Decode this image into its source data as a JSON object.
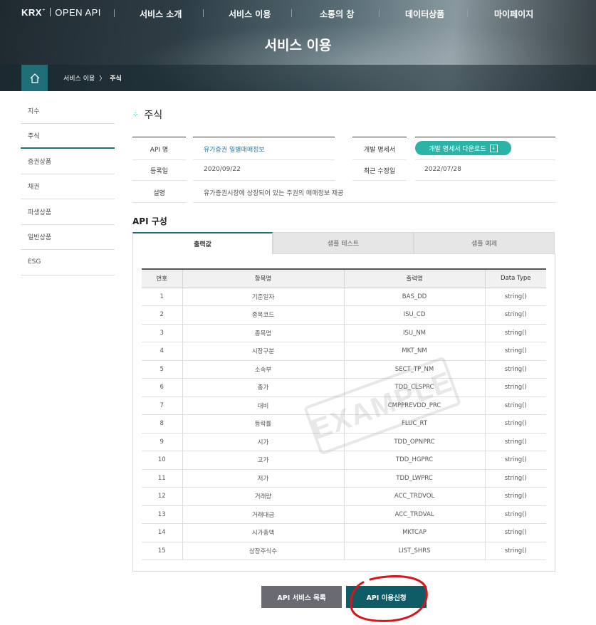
{
  "header": {
    "logo_brand": "KRX",
    "logo_text": "OPEN API",
    "nav": [
      "서비스 소개",
      "서비스 이용",
      "소통의 창",
      "데이터상품",
      "마이페이지"
    ],
    "hero_title": "서비스 이용",
    "breadcrumb": {
      "parent": "서비스 이용",
      "current": "주식"
    }
  },
  "sidebar": {
    "items": [
      {
        "label": "지수"
      },
      {
        "label": "주식"
      },
      {
        "label": "증권상품"
      },
      {
        "label": "채권"
      },
      {
        "label": "파생상품"
      },
      {
        "label": "일반상품"
      },
      {
        "label": "ESG"
      }
    ],
    "active_index": 1
  },
  "page_title": "주식",
  "info": {
    "api_name_label": "API 명",
    "api_name": "유가증권 일별매매정보",
    "reg_date_label": "등록일",
    "reg_date": "2020/09/22",
    "desc_label": "설명",
    "desc": "유가증권시장에 상장되어 있는 주권의 매매정보 제공",
    "spec_label": "개발 명세서",
    "spec_button": "개발 명세서 다운로드",
    "modified_label": "최근 수정일",
    "modified_date": "2022/07/28"
  },
  "api_section_title": "API 구성",
  "tabs": [
    "출력값",
    "샘플 테스트",
    "샘플 예제"
  ],
  "table": {
    "headers": [
      "번호",
      "항목명",
      "출력명",
      "Data Type"
    ],
    "rows": [
      [
        "1",
        "기준일자",
        "BAS_DD",
        "string()"
      ],
      [
        "2",
        "종목코드",
        "ISU_CD",
        "string()"
      ],
      [
        "3",
        "종목명",
        "ISU_NM",
        "string()"
      ],
      [
        "4",
        "시장구분",
        "MKT_NM",
        "string()"
      ],
      [
        "5",
        "소속부",
        "SECT_TP_NM",
        "string()"
      ],
      [
        "6",
        "종가",
        "TDD_CLSPRC",
        "string()"
      ],
      [
        "7",
        "대비",
        "CMPPREVDD_PRC",
        "string()"
      ],
      [
        "8",
        "등락률",
        "FLUC_RT",
        "string()"
      ],
      [
        "9",
        "시가",
        "TDD_OPNPRC",
        "string()"
      ],
      [
        "10",
        "고가",
        "TDD_HGPRC",
        "string()"
      ],
      [
        "11",
        "저가",
        "TDD_LWPRC",
        "string()"
      ],
      [
        "12",
        "거래량",
        "ACC_TRDVOL",
        "string()"
      ],
      [
        "13",
        "거래대금",
        "ACC_TRDVAL",
        "string()"
      ],
      [
        "14",
        "시가총액",
        "MKTCAP",
        "string()"
      ],
      [
        "15",
        "상장주식수",
        "LIST_SHRS",
        "string()"
      ]
    ],
    "watermark": "EXAMPLE"
  },
  "buttons": {
    "list": "API 서비스 목록",
    "apply": "API 이용신청"
  },
  "colors": {
    "accent": "#1f6d77",
    "button_teal": "#2ab3a6",
    "annotation_red": "#d9141b"
  }
}
